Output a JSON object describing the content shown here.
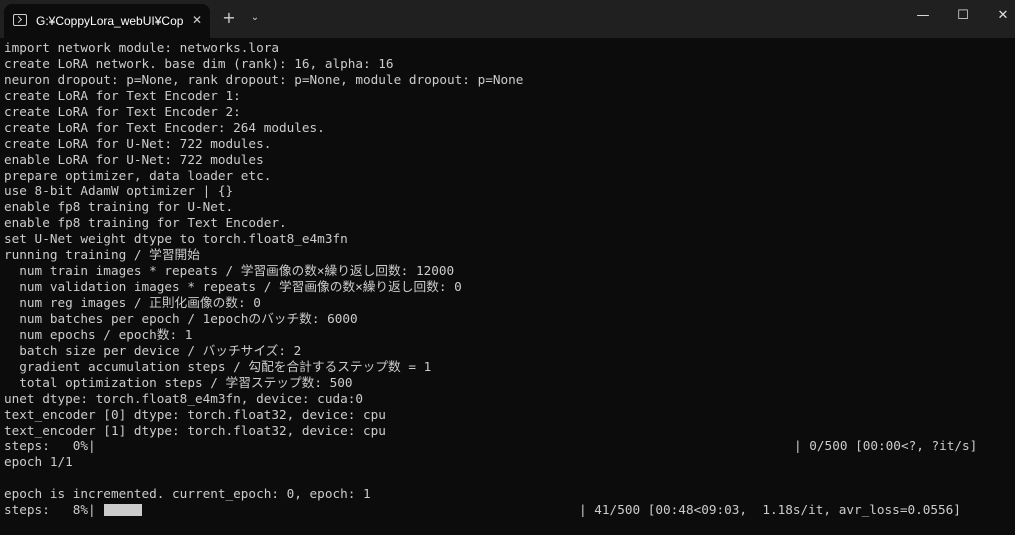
{
  "window": {
    "tab_title": "G:¥CoppyLora_webUI¥CoppyL",
    "tab_close": "✕",
    "new_tab": "+",
    "dropdown": "⌄",
    "minimize": "—",
    "maximize": "☐",
    "close": "✕"
  },
  "terminal": {
    "lines": [
      "import network module: networks.lora",
      "create LoRA network. base dim (rank): 16, alpha: 16",
      "neuron dropout: p=None, rank dropout: p=None, module dropout: p=None",
      "create LoRA for Text Encoder 1:",
      "create LoRA for Text Encoder 2:",
      "create LoRA for Text Encoder: 264 modules.",
      "create LoRA for U-Net: 722 modules.",
      "enable LoRA for U-Net: 722 modules",
      "prepare optimizer, data loader etc.",
      "use 8-bit AdamW optimizer | {}",
      "enable fp8 training for U-Net.",
      "enable fp8 training for Text Encoder.",
      "set U-Net weight dtype to torch.float8_e4m3fn",
      "running training / 学習開始",
      "  num train images * repeats / 学習画像の数×繰り返し回数: 12000",
      "  num validation images * repeats / 学習画像の数×繰り返し回数: 0",
      "  num reg images / 正則化画像の数: 0",
      "  num batches per epoch / 1epochのバッチ数: 6000",
      "  num epochs / epoch数: 1",
      "  batch size per device / バッチサイズ: 2",
      "  gradient accumulation steps / 勾配を合計するステップ数 = 1",
      "  total optimization steps / 学習ステップ数: 500",
      "unet dtype: torch.float8_e4m3fn, device: cuda:0",
      "text_encoder [0] dtype: torch.float32, device: cpu",
      "text_encoder [1] dtype: torch.float32, device: cpu"
    ],
    "progress1": {
      "left": "steps:   0%|",
      "right": "| 0/500 [00:00<?, ?it/s]",
      "fraction": 0.0
    },
    "after_progress1": [
      "epoch 1/1",
      "",
      "epoch is incremented. current_epoch: 0, epoch: 1"
    ],
    "progress2": {
      "left": "steps:   8%|",
      "right": "| 41/500 [00:48<09:03,  1.18s/it, avr_loss=0.0556]",
      "fraction": 0.08
    }
  }
}
